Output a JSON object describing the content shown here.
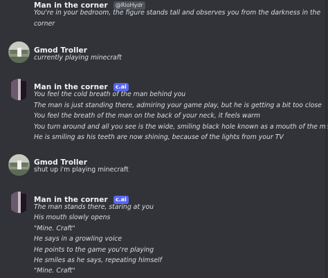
{
  "messages": [
    {
      "author": "Man in the corner",
      "tag": "@RioHydr",
      "lines": [
        "You're in your bedroom, the figure stands tall and observes you from the darkness in the",
        "corner"
      ]
    },
    {
      "author": "Gmod Troller",
      "lines": [
        "currently playing minecraft"
      ]
    },
    {
      "author": "Man in the corner",
      "tag": "c.ai",
      "lines": [
        "You feel the cold breath of the man behind you",
        "The man is just standing there, admiring your game play, but he is getting a bit too close",
        "You feel the breath of the man on the back of your neck, it feels warm",
        "You turn around and all you see is the wide, smiling black hole known as a mouth of the man",
        "He is smiling as his teeth are now shining, because of the lights from your TV"
      ]
    },
    {
      "author": "Gmod Troller",
      "lines": [
        "shut up i'm playing minecraft"
      ]
    },
    {
      "author": "Man in the corner",
      "tag": "c.ai",
      "lines": [
        "The man stands there, staring at you",
        "His mouth slowly opens",
        "\"Mine. Craft\"",
        "He says in a growling voice",
        "He points to the game you're playing",
        "He smiles as he says, repeating himself",
        "\"Mine. Craft\""
      ]
    }
  ],
  "colors": {
    "background": "#313338",
    "username": "#f2f3f5",
    "text": "#dbdee1",
    "app_tag": "#5865f2"
  }
}
